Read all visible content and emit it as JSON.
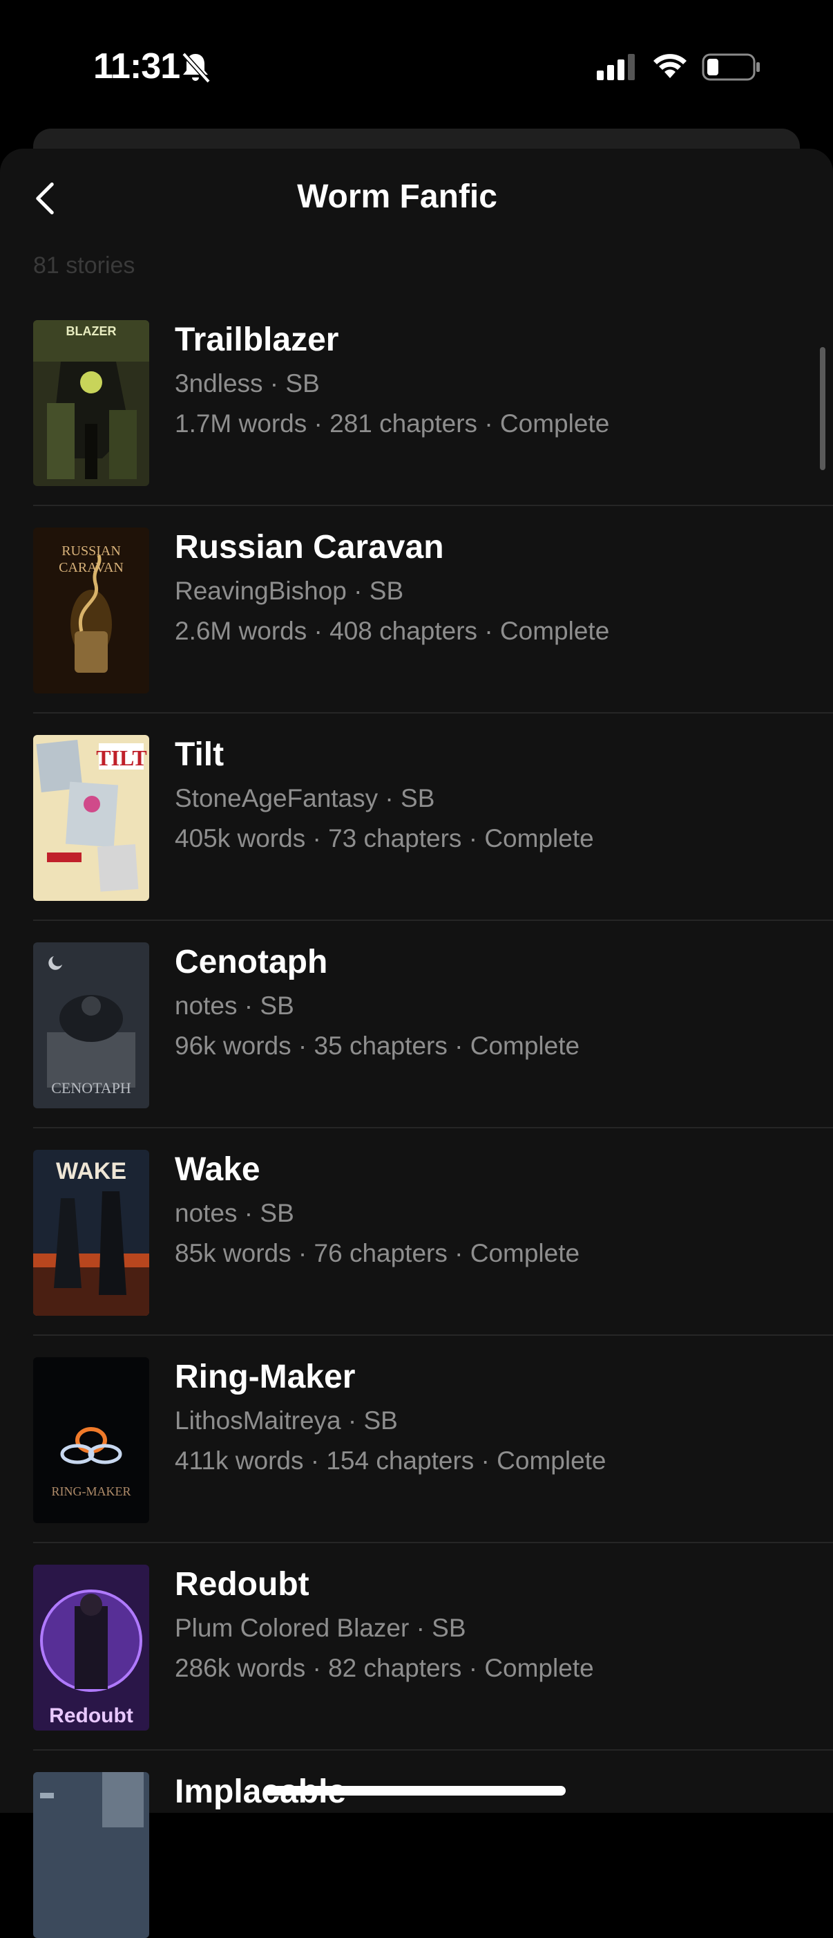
{
  "status_bar": {
    "time": "11:31",
    "icons": [
      "bell-slash-icon",
      "cellular-signal-icon",
      "wifi-icon",
      "battery-icon"
    ]
  },
  "header": {
    "title": "Worm Fanfic",
    "back_icon": "chevron-left-icon"
  },
  "count_label": "81 stories",
  "colors": {
    "background": "#121212",
    "title_text": "#ffffff",
    "secondary_text": "#8e8e8e",
    "divider": "#262626"
  },
  "stories": [
    {
      "title": "Trailblazer",
      "author": "3ndless · SB",
      "meta": "1.7M words · 281 chapters · Complete",
      "cover_text": "BLAZER"
    },
    {
      "title": "Russian Caravan",
      "author": "ReavingBishop · SB",
      "meta": "2.6M words · 408 chapters · Complete",
      "cover_text": "RUSSIAN CARAVAN"
    },
    {
      "title": "Tilt",
      "author": "StoneAgeFantasy · SB",
      "meta": "405k words · 73 chapters · Complete",
      "cover_text": "TILT"
    },
    {
      "title": "Cenotaph",
      "author": "notes · SB",
      "meta": "96k words · 35 chapters · Complete",
      "cover_text": "CENOTAPH"
    },
    {
      "title": "Wake",
      "author": "notes · SB",
      "meta": "85k words · 76 chapters · Complete",
      "cover_text": "WAKE"
    },
    {
      "title": "Ring-Maker",
      "author": "LithosMaitreya · SB",
      "meta": "411k words · 154 chapters · Complete",
      "cover_text": "RING-MAKER"
    },
    {
      "title": "Redoubt",
      "author": "Plum Colored Blazer · SB",
      "meta": "286k words · 82 chapters · Complete",
      "cover_text": "Redoubt"
    },
    {
      "title": "Implacable",
      "author": "",
      "meta": "",
      "cover_text": ""
    }
  ]
}
